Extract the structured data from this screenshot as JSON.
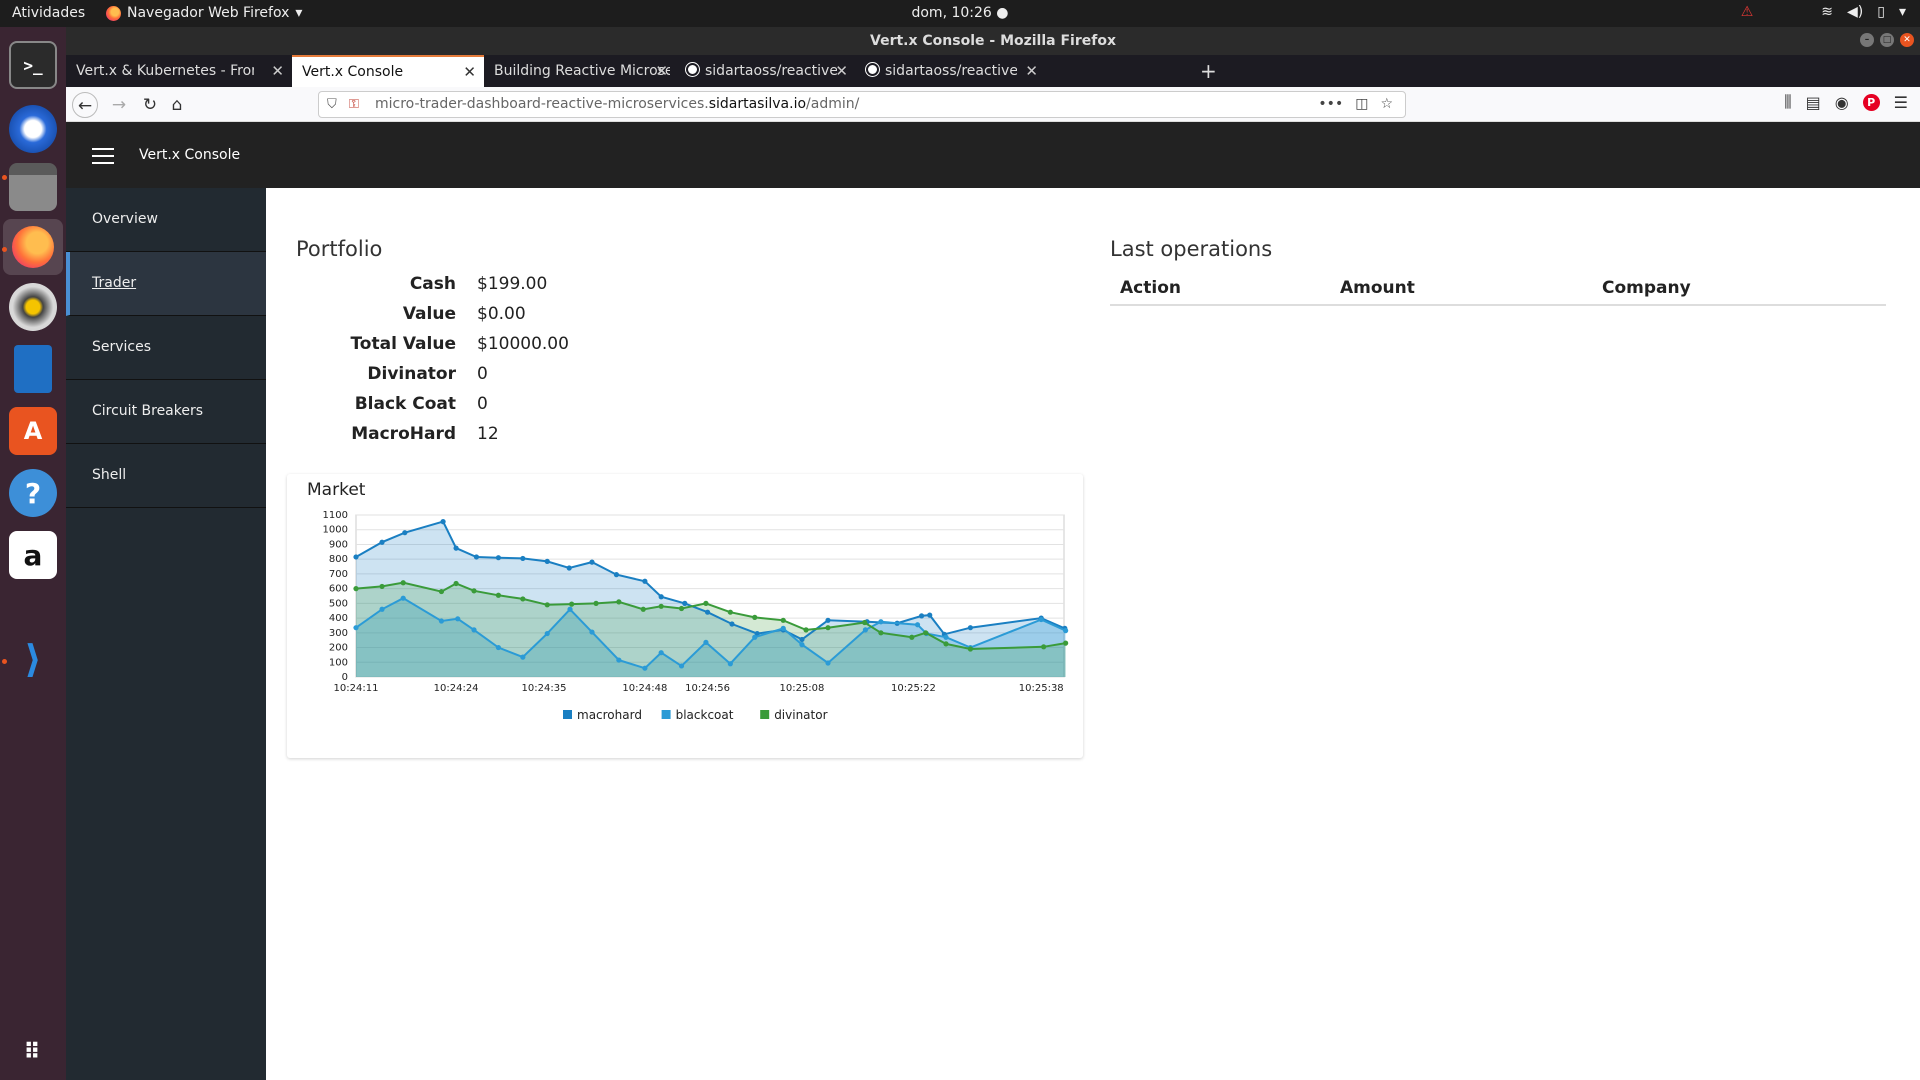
{
  "topbar": {
    "activities": "Atividades",
    "app_name": "Navegador Web Firefox",
    "clock": "dom, 10:26"
  },
  "window": {
    "title": "Vert.x Console - Mozilla Firefox"
  },
  "tabs": [
    {
      "label": "Vert.x & Kubernetes - From"
    },
    {
      "label": "Vert.x Console"
    },
    {
      "label": "Building Reactive Microserv"
    },
    {
      "label": "sidartaoss/reactive-micr"
    },
    {
      "label": "sidartaoss/reactive-micr"
    }
  ],
  "url": {
    "prefix": "micro-trader-dashboard-reactive-microservices.",
    "domain": "sidartasilva.io",
    "path": "/admin/"
  },
  "app": {
    "title": "Vert.x Console"
  },
  "sidebar": {
    "items": [
      {
        "label": "Overview"
      },
      {
        "label": "Trader"
      },
      {
        "label": "Services"
      },
      {
        "label": "Circuit Breakers"
      },
      {
        "label": "Shell"
      }
    ]
  },
  "portfolio": {
    "title": "Portfolio",
    "rows": [
      {
        "key": "Cash",
        "value": "$199.00"
      },
      {
        "key": "Value",
        "value": "$0.00"
      },
      {
        "key": "Total Value",
        "value": "$10000.00"
      },
      {
        "key": "Divinator",
        "value": "0"
      },
      {
        "key": "Black Coat",
        "value": "0"
      },
      {
        "key": "MacroHard",
        "value": "12"
      }
    ]
  },
  "market": {
    "title": "Market"
  },
  "last_operations": {
    "title": "Last operations",
    "columns": [
      "Action",
      "Amount",
      "Company"
    ]
  },
  "chart_data": {
    "type": "area",
    "ylim": [
      0,
      1100
    ],
    "yticks": [
      0,
      100,
      200,
      300,
      400,
      500,
      600,
      700,
      800,
      900,
      1000,
      1100
    ],
    "xtick_labels": [
      "10:24:11",
      "10:24:24",
      "10:24:35",
      "10:24:48",
      "10:24:56",
      "10:25:08",
      "10:25:22",
      "10:25:38"
    ],
    "xlim": [
      0,
      87
    ],
    "xtick_positions": [
      0,
      12.3,
      23.1,
      35.5,
      43.2,
      54.8,
      68.5,
      84.2
    ],
    "grid": true,
    "legend_position": "bottom",
    "colors": {
      "macrohard": "#1a7fc2",
      "blackcoat": "#2b9bd6",
      "divinator": "#3a9b3a"
    },
    "series": [
      {
        "name": "macrohard",
        "x": [
          0,
          3.2,
          6,
          10.7,
          12.3,
          14.8,
          17.5,
          20.5,
          23.5,
          26.2,
          29,
          32,
          35.5,
          37.5,
          40.4,
          43.2,
          46.2,
          49.3,
          52.5,
          54.8,
          58,
          62.8,
          66.5,
          69.5,
          70.5,
          72.3,
          75.5,
          84.2,
          87.1
        ],
        "y": [
          815,
          915,
          980,
          1055,
          875,
          815,
          810,
          805,
          785,
          740,
          780,
          695,
          650,
          545,
          500,
          440,
          360,
          295,
          320,
          255,
          385,
          375,
          365,
          415,
          420,
          290,
          335,
          400,
          330
        ]
      },
      {
        "name": "blackcoat",
        "x": [
          0,
          3.2,
          5.8,
          10.5,
          12.5,
          14.5,
          17.5,
          20.5,
          23.5,
          26.3,
          29,
          32.3,
          35.5,
          37.5,
          40,
          43,
          46,
          49,
          52.5,
          54.8,
          58,
          62.6,
          64.5,
          69,
          70.1,
          72.5,
          75.5,
          84.2,
          87.2
        ],
        "y": [
          335,
          460,
          535,
          380,
          395,
          320,
          200,
          135,
          295,
          460,
          305,
          115,
          60,
          165,
          75,
          235,
          90,
          270,
          330,
          220,
          95,
          320,
          375,
          355,
          295,
          270,
          200,
          390,
          315
        ]
      },
      {
        "name": "divinator",
        "x": [
          0,
          3.2,
          5.8,
          10.5,
          12.3,
          14.5,
          17.5,
          20.5,
          23.5,
          26.5,
          29.5,
          32.3,
          35.3,
          37.5,
          40,
          43,
          46,
          49,
          52.5,
          55.3,
          58,
          62.5,
          64.5,
          68.3,
          70,
          72.5,
          75.5,
          84.5,
          87.2
        ],
        "y": [
          600,
          615,
          640,
          580,
          635,
          585,
          555,
          530,
          490,
          495,
          500,
          510,
          460,
          480,
          465,
          500,
          440,
          405,
          385,
          320,
          335,
          370,
          300,
          270,
          300,
          225,
          190,
          205,
          230
        ]
      }
    ]
  }
}
